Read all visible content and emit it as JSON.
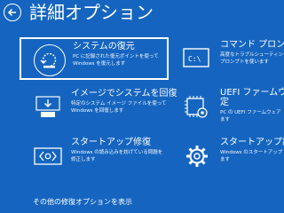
{
  "page": {
    "title": "詳細オプション"
  },
  "options": [
    {
      "title": "システムの復元",
      "description": "PC に記録された復元ポイントを使って\nWindows を復元します",
      "icon": "system-restore-icon",
      "selected": true
    },
    {
      "title": "コマンド プロンプト",
      "description": "高度なトラブルシューティングのために\nプロンプトを使います",
      "icon": "command-prompt-icon",
      "selected": false
    },
    {
      "title": "イメージでシステムを回復",
      "description": "特定のシステム イメージ ファイルを使って\nWindows を回復します",
      "icon": "system-image-recovery-icon",
      "selected": false
    },
    {
      "title": "UEFI ファームウェア\n定",
      "description": "PC の UEFI ファームウェア\nます",
      "icon": "uefi-settings-icon",
      "selected": false
    },
    {
      "title": "スタートアップ修復",
      "description": "Windows の読み込みを妨げている問題を\n修正します",
      "icon": "startup-repair-icon",
      "selected": false
    },
    {
      "title": "スタートアップ設定",
      "description": "Windows のスタートアップ\nます",
      "icon": "startup-settings-icon",
      "selected": false
    }
  ],
  "footer": {
    "more_options_label": "その他の修復オプションを表示"
  },
  "colors": {
    "background": "#1565C0",
    "foreground": "#FFFFFF"
  }
}
